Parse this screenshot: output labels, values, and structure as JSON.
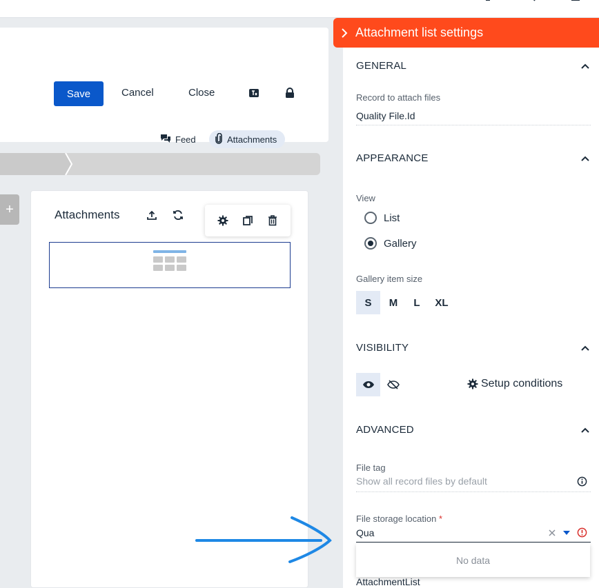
{
  "header": {
    "save_label": "Save",
    "cancel_label": "Cancel",
    "close_label": "Close",
    "tabs": [
      {
        "label": "Feed"
      },
      {
        "label": "Attachments"
      }
    ]
  },
  "canvas": {
    "component_title": "Attachments",
    "plus_label": "+"
  },
  "panel": {
    "title": "Attachment list settings",
    "header_color": "#ff4a1c",
    "general": {
      "title": "GENERAL",
      "record_label": "Record to attach files",
      "record_value": "Quality File.Id"
    },
    "appearance": {
      "title": "APPEARANCE",
      "view_label": "View",
      "view_options": [
        "List",
        "Gallery"
      ],
      "view_selected": "Gallery",
      "size_label": "Gallery item size",
      "sizes": [
        "S",
        "M",
        "L",
        "XL"
      ],
      "size_selected": "S"
    },
    "visibility": {
      "title": "VISIBILITY",
      "setup_label": "Setup conditions"
    },
    "advanced": {
      "title": "ADVANCED",
      "file_tag_label": "File tag",
      "file_tag_placeholder": "Show all record files by default",
      "storage_label": "File storage location",
      "required_mark": "*",
      "storage_value": "Qua",
      "dropdown_empty": "No data",
      "next_value": "AttachmentList"
    }
  },
  "colors": {
    "primary": "#0a58ca",
    "accent": "#ff4a1c",
    "annotation_arrow": "#1e88e5"
  }
}
